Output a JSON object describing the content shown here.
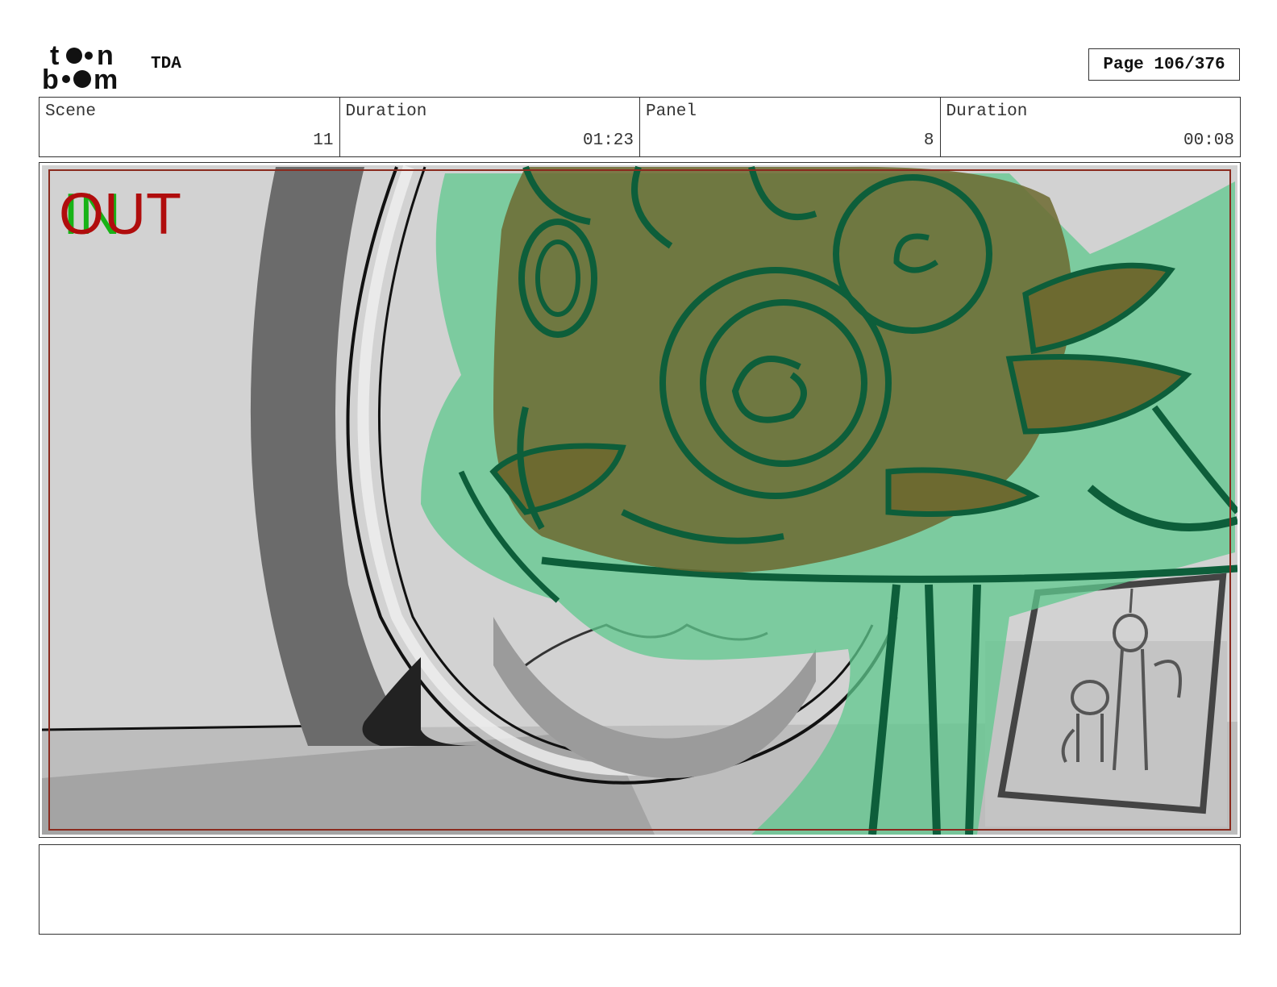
{
  "header": {
    "logo_text": "toon boom",
    "project": "TDA",
    "page": "Page 106/376"
  },
  "info": {
    "scene_label": "Scene",
    "scene_value": "11",
    "scene_duration_label": "Duration",
    "scene_duration_value": "01:23",
    "panel_label": "Panel",
    "panel_value": "8",
    "panel_duration_label": "Duration",
    "panel_duration_value": "00:08"
  },
  "panel": {
    "in_label": "IN",
    "out_label": "OUT",
    "colors": {
      "safe_border": "#8a2a1e",
      "in": "#17b317",
      "out": "#b00d0d",
      "leaf_fill": "#7ccfa0",
      "leaf_stroke": "#0d5e3a",
      "rose_fill": "#6d6a30"
    }
  },
  "notes": {
    "text": ""
  }
}
